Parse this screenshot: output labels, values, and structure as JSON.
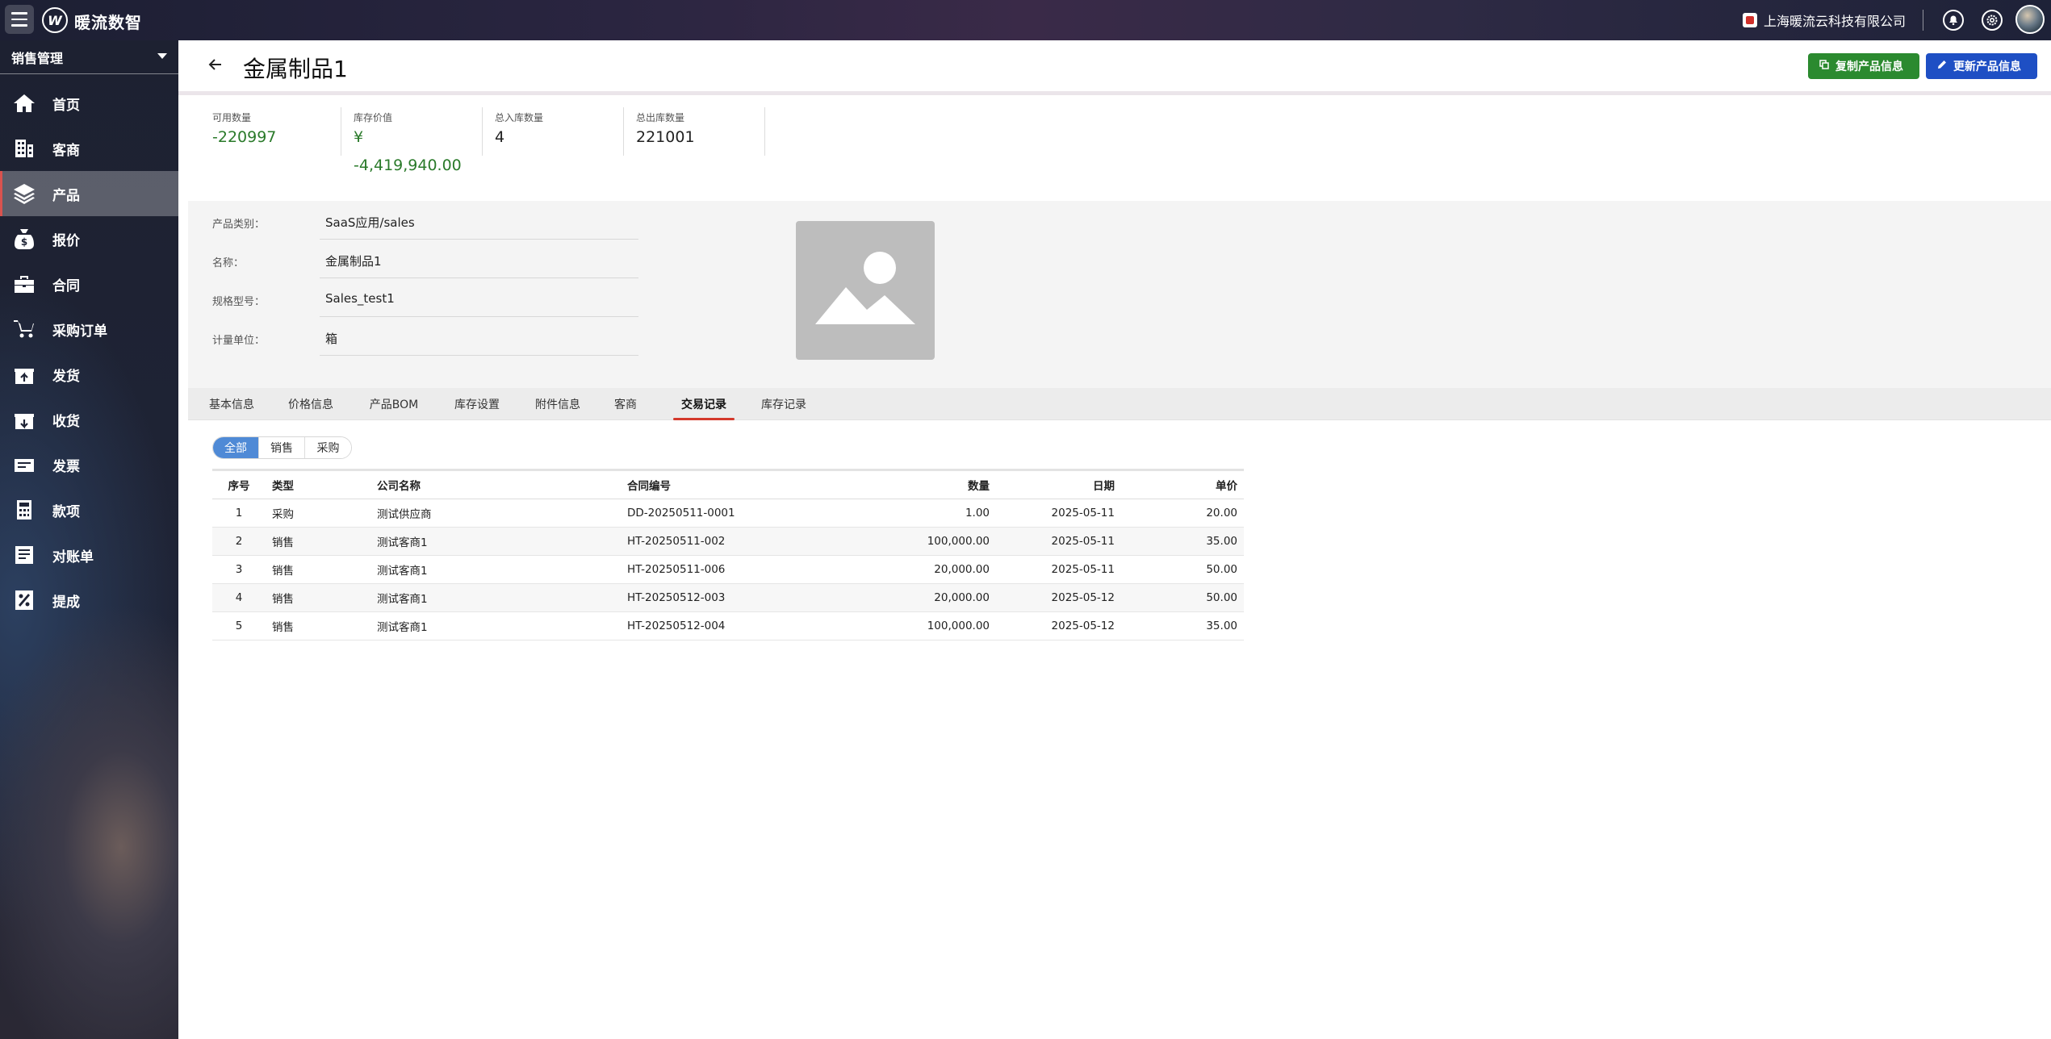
{
  "topbar": {
    "app_name": "暖流数智",
    "company": "上海暖流云科技有限公司"
  },
  "sidebar": {
    "module": "销售管理",
    "items": [
      {
        "label": "首页",
        "icon": "home-icon"
      },
      {
        "label": "客商",
        "icon": "building-icon"
      },
      {
        "label": "产品",
        "icon": "layers-icon",
        "active": true
      },
      {
        "label": "报价",
        "icon": "money-bag-icon"
      },
      {
        "label": "合同",
        "icon": "briefcase-icon"
      },
      {
        "label": "采购订单",
        "icon": "cart-icon"
      },
      {
        "label": "发货",
        "icon": "box-out-icon"
      },
      {
        "label": "收货",
        "icon": "box-in-icon"
      },
      {
        "label": "发票",
        "icon": "invoice-icon"
      },
      {
        "label": "款项",
        "icon": "calculator-icon"
      },
      {
        "label": "对账单",
        "icon": "statement-icon"
      },
      {
        "label": "提成",
        "icon": "percent-icon"
      }
    ]
  },
  "header": {
    "title": "金属制品1",
    "copy_label": "复制产品信息",
    "update_label": "更新产品信息"
  },
  "stats": [
    {
      "label": "可用数量",
      "value": "-220997"
    },
    {
      "label": "库存价值",
      "value": "¥",
      "value2": "-4,419,940.00"
    },
    {
      "label": "总入库数量",
      "value": "4"
    },
    {
      "label": "总出库数量",
      "value": "221001"
    }
  ],
  "info": [
    {
      "label": "产品类别：",
      "value": "SaaS应用/sales"
    },
    {
      "label": "名称：",
      "value": "金属制品1"
    },
    {
      "label": "规格型号：",
      "value": "Sales_test1"
    },
    {
      "label": "计量单位：",
      "value": "箱"
    }
  ],
  "tabs": [
    "基本信息",
    "价格信息",
    "产品BOM",
    "库存设置",
    "附件信息",
    "客商",
    "交易记录",
    "库存记录"
  ],
  "active_tab": "交易记录",
  "filters": [
    "全部",
    "销售",
    "采购"
  ],
  "active_filter": "全部",
  "table": {
    "columns": [
      "序号",
      "类型",
      "公司名称",
      "合同编号",
      "数量",
      "日期",
      "单价"
    ],
    "rows": [
      [
        "1",
        "采购",
        "测试供应商",
        "DD-20250511-0001",
        "1.00",
        "2025-05-11",
        "20.00"
      ],
      [
        "2",
        "销售",
        "测试客商1",
        "HT-20250511-002",
        "100,000.00",
        "2025-05-11",
        "35.00"
      ],
      [
        "3",
        "销售",
        "测试客商1",
        "HT-20250511-006",
        "20,000.00",
        "2025-05-11",
        "50.00"
      ],
      [
        "4",
        "销售",
        "测试客商1",
        "HT-20250512-003",
        "20,000.00",
        "2025-05-12",
        "50.00"
      ],
      [
        "5",
        "销售",
        "测试客商1",
        "HT-20250512-004",
        "100,000.00",
        "2025-05-12",
        "35.00"
      ]
    ]
  }
}
